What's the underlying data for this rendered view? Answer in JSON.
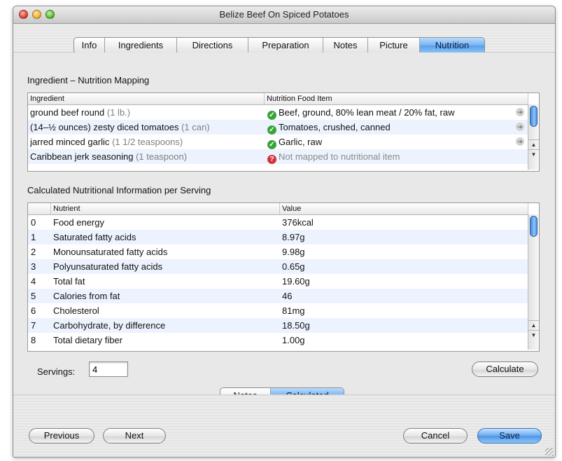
{
  "window": {
    "title": "Belize Beef On Spiced Potatoes"
  },
  "tabs": [
    {
      "label": "Info",
      "selected": false
    },
    {
      "label": "Ingredients",
      "selected": false
    },
    {
      "label": "Directions",
      "selected": false
    },
    {
      "label": "Preparation",
      "selected": false
    },
    {
      "label": "Notes",
      "selected": false
    },
    {
      "label": "Picture",
      "selected": false
    },
    {
      "label": "Nutrition",
      "selected": true
    }
  ],
  "mapping": {
    "title": "Ingredient – Nutrition Mapping",
    "columns": [
      "Ingredient",
      "Nutrition Food Item"
    ],
    "rows": [
      {
        "name": "ground beef round",
        "qty": "(1 lb.)",
        "mapped": true,
        "food": "Beef, ground, 80% lean meat / 20% fat, raw"
      },
      {
        "name": "(14–½ ounces) zesty diced tomatoes",
        "qty": "(1 can)",
        "mapped": true,
        "food": "Tomatoes, crushed, canned"
      },
      {
        "name": "jarred minced garlic",
        "qty": "(1 1/2 teaspoons)",
        "mapped": true,
        "food": "Garlic, raw"
      },
      {
        "name": "Caribbean jerk seasoning",
        "qty": "(1 teaspoon)",
        "mapped": false,
        "food": "Not mapped to nutritional item"
      }
    ]
  },
  "nutrition": {
    "title": "Calculated Nutritional Information per Serving",
    "columns": [
      "",
      "Nutrient",
      "Value"
    ],
    "rows": [
      {
        "index": "0",
        "nutrient": "Food energy",
        "value": "376kcal"
      },
      {
        "index": "1",
        "nutrient": "Saturated fatty acids",
        "value": "8.97g"
      },
      {
        "index": "2",
        "nutrient": "Monounsaturated fatty acids",
        "value": "9.98g"
      },
      {
        "index": "3",
        "nutrient": "Polyunsaturated fatty acids",
        "value": "0.65g"
      },
      {
        "index": "4",
        "nutrient": "Total fat",
        "value": "19.60g"
      },
      {
        "index": "5",
        "nutrient": "Calories from fat",
        "value": "46"
      },
      {
        "index": "6",
        "nutrient": "Cholesterol",
        "value": "81mg"
      },
      {
        "index": "7",
        "nutrient": "Carbohydrate, by difference",
        "value": "18.50g"
      },
      {
        "index": "8",
        "nutrient": "Total dietary fiber",
        "value": "1.00g"
      }
    ]
  },
  "servings": {
    "label": "Servings:",
    "value": "4"
  },
  "buttons": {
    "calculate": "Calculate",
    "previous": "Previous",
    "next": "Next",
    "cancel": "Cancel",
    "save": "Save"
  },
  "view_toggle": [
    {
      "label": "Notes",
      "selected": false
    },
    {
      "label": "Calculated",
      "selected": true
    }
  ],
  "icons": {
    "mapped": "check-circle-icon",
    "unmapped": "question-circle-icon",
    "row_action": "arrow-circle-icon"
  },
  "colors": {
    "selection_blue": "#5b9ee9",
    "mapped_green": "#3aa43a",
    "unmapped_red": "#d0343a"
  }
}
